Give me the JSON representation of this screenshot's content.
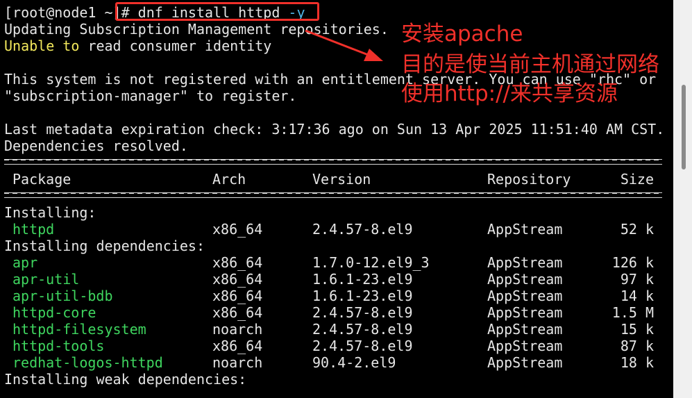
{
  "terminal": {
    "prompt": "[root@node1 ~]",
    "command_prefix": "# dnf install httpd ",
    "command_flag": "-y",
    "line_updating": "Updating Subscription Management repositories.",
    "line_unable_word": "Unable",
    "line_to_word": "to",
    "line_unable_rest": "read consumer identity",
    "line_not_registered": "This system is not registered with an entitlement server. You can use \"rhc\" or",
    "line_subscription_manager": "\"subscription-manager\" to register.",
    "line_metadata": "Last metadata expiration check: 3:17:36 ago on Sun 13 Apr 2025 11:51:40 AM CST.",
    "line_deps_resolved": "Dependencies resolved.",
    "table_headers": {
      "package": "Package",
      "arch": "Arch",
      "version": "Version",
      "repository": "Repository",
      "size": "Size"
    },
    "section_installing": "Installing:",
    "section_installing_deps": "Installing dependencies:",
    "section_installing_weak": "Installing weak dependencies:",
    "installing": [
      {
        "name": "httpd",
        "arch": "x86_64",
        "version": "2.4.57-8.el9",
        "repo": "AppStream",
        "size": "52 k"
      }
    ],
    "dependencies": [
      {
        "name": "apr",
        "arch": "x86_64",
        "version": "1.7.0-12.el9_3",
        "repo": "AppStream",
        "size": "126 k"
      },
      {
        "name": "apr-util",
        "arch": "x86_64",
        "version": "1.6.1-23.el9",
        "repo": "AppStream",
        "size": "97 k"
      },
      {
        "name": "apr-util-bdb",
        "arch": "x86_64",
        "version": "1.6.1-23.el9",
        "repo": "AppStream",
        "size": "14 k"
      },
      {
        "name": "httpd-core",
        "arch": "x86_64",
        "version": "2.4.57-8.el9",
        "repo": "AppStream",
        "size": "1.5 M"
      },
      {
        "name": "httpd-filesystem",
        "arch": "noarch",
        "version": "2.4.57-8.el9",
        "repo": "AppStream",
        "size": "15 k"
      },
      {
        "name": "httpd-tools",
        "arch": "x86_64",
        "version": "2.4.57-8.el9",
        "repo": "AppStream",
        "size": "87 k"
      },
      {
        "name": "redhat-logos-httpd",
        "arch": "noarch",
        "version": "90.4-2.el9",
        "repo": "AppStream",
        "size": "18 k"
      }
    ]
  },
  "annotation": {
    "line1": "安装apache",
    "line2": "目的是使当前主机通过网络",
    "line3": "使用http://来共享资源"
  },
  "colors": {
    "background": "#000000",
    "text": "#e6e6e6",
    "package_name": "#3fd65f",
    "warning": "#f2e85c",
    "flag": "#4fb7e8",
    "annotation": "#f0302a"
  }
}
